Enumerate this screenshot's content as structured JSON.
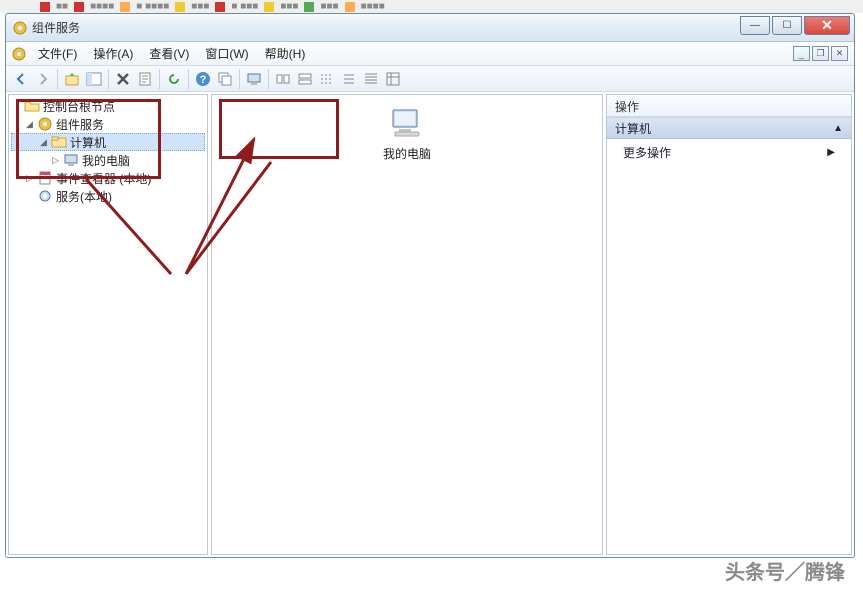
{
  "title": "组件服务",
  "menubar": {
    "file": "文件(F)",
    "action": "操作(A)",
    "view": "查看(V)",
    "window": "窗口(W)",
    "help": "帮助(H)"
  },
  "winbtns": {
    "min": "—",
    "max": "☐",
    "close": "✕"
  },
  "tree": {
    "root": {
      "label": "控制台根节点"
    },
    "svc": {
      "label": "组件服务"
    },
    "computers": {
      "label": "计算机"
    },
    "mycomp": {
      "label": "我的电脑"
    },
    "eventvwr": {
      "label": "事件查看器 (本地)"
    },
    "services": {
      "label": "服务(本地)"
    }
  },
  "list": {
    "mycomp": "我的电脑"
  },
  "actions": {
    "title": "操作",
    "group": "计算机",
    "more": "更多操作"
  },
  "watermark": "头条号／腾锋"
}
